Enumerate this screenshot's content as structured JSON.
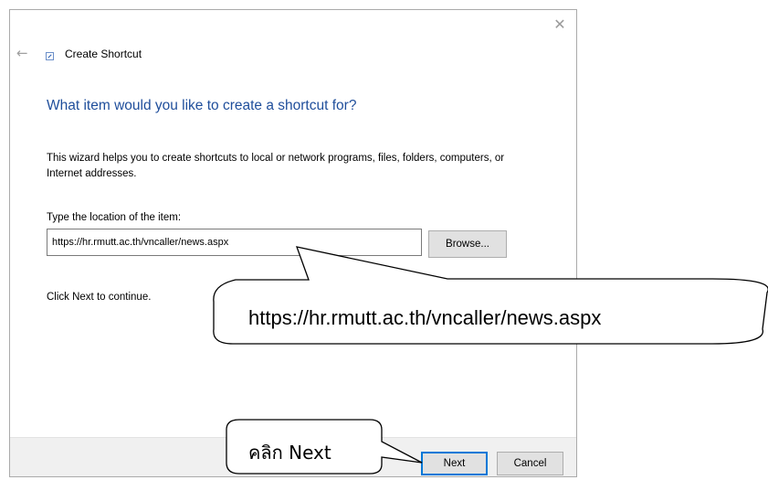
{
  "window": {
    "title": "Create Shortcut",
    "close_glyph": "✕",
    "back_glyph": "←"
  },
  "main": {
    "heading": "What item would you like to create a shortcut for?",
    "description": "This wizard helps you to create shortcuts to local or network programs, files, folders, computers, or Internet addresses.",
    "location_label": "Type the location of the item:",
    "location_value": "https://hr.rmutt.ac.th/vncaller/news.aspx",
    "browse_label": "Browse...",
    "continue_text": "Click Next to continue."
  },
  "footer": {
    "next_label": "Next",
    "cancel_label": "Cancel"
  },
  "annotations": {
    "url_callout": "https://hr.rmutt.ac.th/vncaller/news.aspx",
    "next_callout": "คลิก Next"
  },
  "colors": {
    "heading": "#1f4e9b",
    "accent": "#0078d7",
    "footer_bg": "#f0f0f0"
  }
}
